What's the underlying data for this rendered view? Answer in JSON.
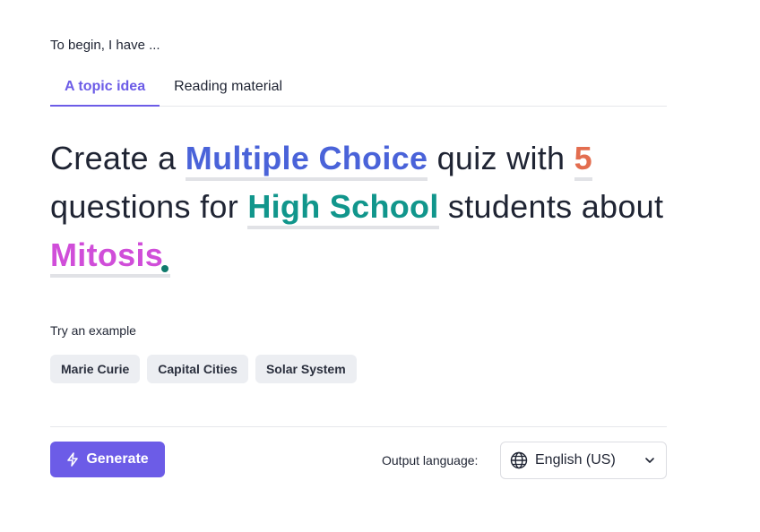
{
  "intro": "To begin, I have ...",
  "tabs": [
    {
      "label": "A topic idea",
      "active": true
    },
    {
      "label": "Reading material",
      "active": false
    }
  ],
  "sentence": {
    "part1": "Create a ",
    "quiz_type": "Multiple Choice",
    "part2": " quiz with ",
    "count": "5",
    "part3": " questions for ",
    "level": "High School",
    "part4": " students about ",
    "topic": "Mitosis"
  },
  "examples": {
    "label": "Try an example",
    "items": [
      "Marie Curie",
      "Capital Cities",
      "Solar System"
    ]
  },
  "generate": {
    "label": "Generate",
    "icon": "lightning-icon"
  },
  "output_language": {
    "label": "Output language:",
    "value": "English (US)",
    "icon": "globe-icon"
  },
  "colors": {
    "accent": "#6c5ce7",
    "quiz_type": "#4a63d9",
    "count": "#e36d4f",
    "level": "#11968c",
    "topic": "#d04ed9"
  }
}
